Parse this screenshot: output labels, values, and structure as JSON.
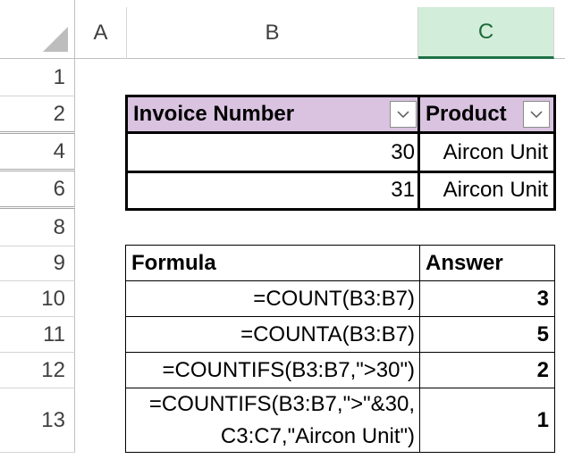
{
  "columns": {
    "a": "A",
    "b": "B",
    "c": "C"
  },
  "rows": [
    "1",
    "2",
    "4",
    "6",
    "8",
    "9",
    "10",
    "11",
    "12",
    "13"
  ],
  "table": {
    "headers": [
      "Invoice Number",
      "Product"
    ],
    "rows": [
      {
        "invoice": "30",
        "product": "Aircon Unit"
      },
      {
        "invoice": "31",
        "product": "Aircon Unit"
      }
    ]
  },
  "formulas": {
    "header_formula": "Formula",
    "header_answer": "Answer",
    "rows": [
      {
        "formula": "=COUNT(B3:B7)",
        "answer": "3"
      },
      {
        "formula": "=COUNTA(B3:B7)",
        "answer": "5"
      },
      {
        "formula": "=COUNTIFS(B3:B7,\">30\")",
        "answer": "2"
      },
      {
        "formula_line1": "=COUNTIFS(B3:B7,\">\"&30,",
        "formula_line2": "C3:C7,\"Aircon Unit\")",
        "answer": "1"
      }
    ]
  },
  "colors": {
    "header_fill": "#d9c3e0",
    "selected_column_fill": "#d3eddb",
    "selected_column_accent": "#1e7145"
  },
  "icons": [
    "select-all-triangle-icon",
    "filter-dropdown-icon"
  ]
}
